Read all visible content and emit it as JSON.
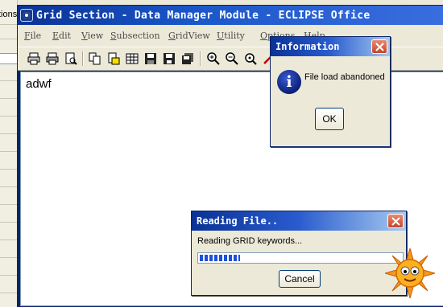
{
  "background_window": {
    "title_fragment": "tions"
  },
  "main_window": {
    "title": "Grid Section - Data Manager Module - ECLIPSE Office",
    "menu": [
      "File",
      "Edit",
      "View",
      "Subsection",
      "GridView",
      "Utility",
      "Options",
      "Help"
    ],
    "toolbar_icons": [
      "print-icon",
      "print-preview-icon",
      "page-preview-icon",
      "copy-icon",
      "highlight-icon",
      "grid-icon",
      "save-icon",
      "save-as-icon",
      "save-all-icon",
      "zoom-in-icon",
      "zoom-out-icon",
      "zoom-reset-icon",
      "ruler-icon"
    ],
    "content_text": "adwf"
  },
  "info_dialog": {
    "title": "Information",
    "message": "File load abandoned",
    "ok_label": "OK",
    "icon": "info-icon"
  },
  "reading_dialog": {
    "title": "Reading File..",
    "message": "Reading GRID keywords...",
    "progress": 0.2,
    "cancel_label": "Cancel"
  },
  "colors": {
    "title_bar": "#0a246a",
    "progress": "#2050d8",
    "close_button": "#c4462a"
  }
}
